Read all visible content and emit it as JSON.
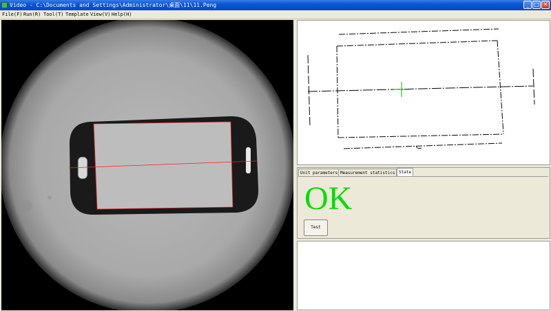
{
  "window": {
    "title": "Video - C:\\Documents and Settings\\Administrator\\桌面\\11\\11.Peng",
    "minimize_glyph": "_",
    "maximize_glyph": "□",
    "close_glyph": "✕"
  },
  "menu": {
    "items": [
      {
        "label": "File(F)"
      },
      {
        "label": "Run(R)"
      },
      {
        "label": "Tool(T)"
      },
      {
        "label": "Template"
      },
      {
        "label": "View(V)"
      },
      {
        "label": "Help(H)"
      }
    ]
  },
  "tabs": [
    {
      "label": "Unit parameters"
    },
    {
      "label": "Measurement statistics"
    },
    {
      "label": "State"
    }
  ],
  "status": {
    "result": "OK",
    "result_color": "#00e000"
  },
  "buttons": {
    "test_label": "Test"
  },
  "colors": {
    "measurement_line": "#ff2020",
    "crosshair": "#00b000",
    "titlebar": "#0a58d6"
  }
}
